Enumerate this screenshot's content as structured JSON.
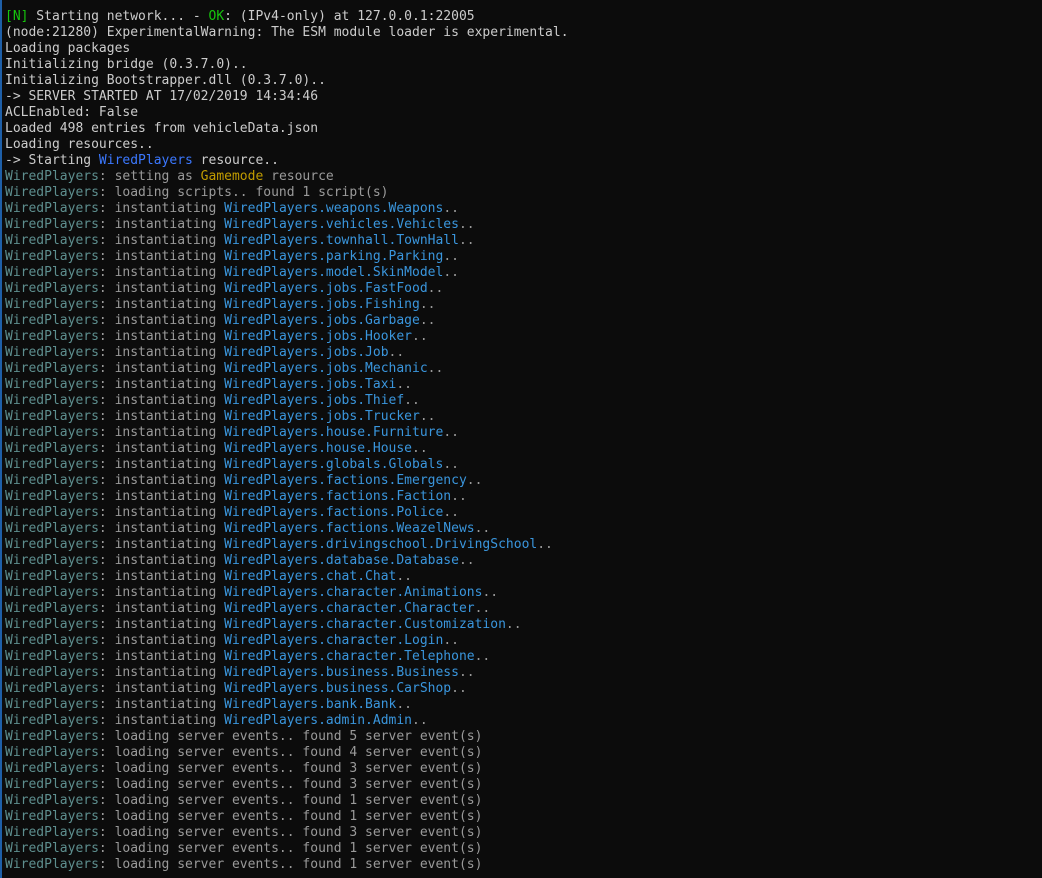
{
  "colors": {
    "background": "#0c0c0c",
    "default_text": "#cccccc",
    "green": "#16c60c",
    "blue": "#3b78ff",
    "wiredplayers_prefix": "#5e8f8f",
    "class_name": "#3a96dd",
    "left_border": "#1e5fa8"
  },
  "lines": [
    [
      {
        "text": "[N]",
        "color": "green"
      },
      {
        "text": " Starting network... - ",
        "color": "white"
      },
      {
        "text": "OK",
        "color": "green"
      },
      {
        "text": ": (IPv4-only) at 127.0.0.1:22005",
        "color": "white"
      }
    ],
    [
      {
        "text": "(node:21280) ExperimentalWarning: The ESM module loader is experimental.",
        "color": "white"
      }
    ],
    [
      {
        "text": "Loading packages",
        "color": "white"
      }
    ],
    [
      {
        "text": "Initializing bridge (0.3.7.0)..",
        "color": "white"
      }
    ],
    [
      {
        "text": "Initializing Bootstrapper.dll (0.3.7.0)..",
        "color": "white"
      }
    ],
    [
      {
        "text": "-> SERVER STARTED AT 17/02/2019 14:34:46",
        "color": "white"
      }
    ],
    [
      {
        "text": "ACLEnabled: False",
        "color": "white"
      }
    ],
    [
      {
        "text": "Loaded 498 entries from vehicleData.json",
        "color": "white"
      }
    ],
    [
      {
        "text": "Loading resources..",
        "color": "white"
      }
    ],
    [
      {
        "text": "-> Starting ",
        "color": "white"
      },
      {
        "text": "WiredPlayers",
        "color": "blue"
      },
      {
        "text": " resource..",
        "color": "white"
      }
    ],
    [
      {
        "text": "WiredPlayers",
        "color": "wp"
      },
      {
        "text": ": setting as ",
        "color": "gray"
      },
      {
        "text": "Gamemode",
        "color": "amber"
      },
      {
        "text": " resource",
        "color": "gray"
      }
    ],
    [
      {
        "text": "WiredPlayers",
        "color": "wp"
      },
      {
        "text": ": loading scripts.. found 1 script(s)",
        "color": "gray"
      }
    ],
    [
      {
        "text": "WiredPlayers",
        "color": "wp"
      },
      {
        "text": ": instantiating ",
        "color": "gray"
      },
      {
        "text": "WiredPlayers.weapons.Weapons",
        "color": "teal"
      },
      {
        "text": "..",
        "color": "gray"
      }
    ],
    [
      {
        "text": "WiredPlayers",
        "color": "wp"
      },
      {
        "text": ": instantiating ",
        "color": "gray"
      },
      {
        "text": "WiredPlayers.vehicles.Vehicles",
        "color": "teal"
      },
      {
        "text": "..",
        "color": "gray"
      }
    ],
    [
      {
        "text": "WiredPlayers",
        "color": "wp"
      },
      {
        "text": ": instantiating ",
        "color": "gray"
      },
      {
        "text": "WiredPlayers.townhall.TownHall",
        "color": "teal"
      },
      {
        "text": "..",
        "color": "gray"
      }
    ],
    [
      {
        "text": "WiredPlayers",
        "color": "wp"
      },
      {
        "text": ": instantiating ",
        "color": "gray"
      },
      {
        "text": "WiredPlayers.parking.Parking",
        "color": "teal"
      },
      {
        "text": "..",
        "color": "gray"
      }
    ],
    [
      {
        "text": "WiredPlayers",
        "color": "wp"
      },
      {
        "text": ": instantiating ",
        "color": "gray"
      },
      {
        "text": "WiredPlayers.model.SkinModel",
        "color": "teal"
      },
      {
        "text": "..",
        "color": "gray"
      }
    ],
    [
      {
        "text": "WiredPlayers",
        "color": "wp"
      },
      {
        "text": ": instantiating ",
        "color": "gray"
      },
      {
        "text": "WiredPlayers.jobs.FastFood",
        "color": "teal"
      },
      {
        "text": "..",
        "color": "gray"
      }
    ],
    [
      {
        "text": "WiredPlayers",
        "color": "wp"
      },
      {
        "text": ": instantiating ",
        "color": "gray"
      },
      {
        "text": "WiredPlayers.jobs.Fishing",
        "color": "teal"
      },
      {
        "text": "..",
        "color": "gray"
      }
    ],
    [
      {
        "text": "WiredPlayers",
        "color": "wp"
      },
      {
        "text": ": instantiating ",
        "color": "gray"
      },
      {
        "text": "WiredPlayers.jobs.Garbage",
        "color": "teal"
      },
      {
        "text": "..",
        "color": "gray"
      }
    ],
    [
      {
        "text": "WiredPlayers",
        "color": "wp"
      },
      {
        "text": ": instantiating ",
        "color": "gray"
      },
      {
        "text": "WiredPlayers.jobs.Hooker",
        "color": "teal"
      },
      {
        "text": "..",
        "color": "gray"
      }
    ],
    [
      {
        "text": "WiredPlayers",
        "color": "wp"
      },
      {
        "text": ": instantiating ",
        "color": "gray"
      },
      {
        "text": "WiredPlayers.jobs.Job",
        "color": "teal"
      },
      {
        "text": "..",
        "color": "gray"
      }
    ],
    [
      {
        "text": "WiredPlayers",
        "color": "wp"
      },
      {
        "text": ": instantiating ",
        "color": "gray"
      },
      {
        "text": "WiredPlayers.jobs.Mechanic",
        "color": "teal"
      },
      {
        "text": "..",
        "color": "gray"
      }
    ],
    [
      {
        "text": "WiredPlayers",
        "color": "wp"
      },
      {
        "text": ": instantiating ",
        "color": "gray"
      },
      {
        "text": "WiredPlayers.jobs.Taxi",
        "color": "teal"
      },
      {
        "text": "..",
        "color": "gray"
      }
    ],
    [
      {
        "text": "WiredPlayers",
        "color": "wp"
      },
      {
        "text": ": instantiating ",
        "color": "gray"
      },
      {
        "text": "WiredPlayers.jobs.Thief",
        "color": "teal"
      },
      {
        "text": "..",
        "color": "gray"
      }
    ],
    [
      {
        "text": "WiredPlayers",
        "color": "wp"
      },
      {
        "text": ": instantiating ",
        "color": "gray"
      },
      {
        "text": "WiredPlayers.jobs.Trucker",
        "color": "teal"
      },
      {
        "text": "..",
        "color": "gray"
      }
    ],
    [
      {
        "text": "WiredPlayers",
        "color": "wp"
      },
      {
        "text": ": instantiating ",
        "color": "gray"
      },
      {
        "text": "WiredPlayers.house.Furniture",
        "color": "teal"
      },
      {
        "text": "..",
        "color": "gray"
      }
    ],
    [
      {
        "text": "WiredPlayers",
        "color": "wp"
      },
      {
        "text": ": instantiating ",
        "color": "gray"
      },
      {
        "text": "WiredPlayers.house.House",
        "color": "teal"
      },
      {
        "text": "..",
        "color": "gray"
      }
    ],
    [
      {
        "text": "WiredPlayers",
        "color": "wp"
      },
      {
        "text": ": instantiating ",
        "color": "gray"
      },
      {
        "text": "WiredPlayers.globals.Globals",
        "color": "teal"
      },
      {
        "text": "..",
        "color": "gray"
      }
    ],
    [
      {
        "text": "WiredPlayers",
        "color": "wp"
      },
      {
        "text": ": instantiating ",
        "color": "gray"
      },
      {
        "text": "WiredPlayers.factions.Emergency",
        "color": "teal"
      },
      {
        "text": "..",
        "color": "gray"
      }
    ],
    [
      {
        "text": "WiredPlayers",
        "color": "wp"
      },
      {
        "text": ": instantiating ",
        "color": "gray"
      },
      {
        "text": "WiredPlayers.factions.Faction",
        "color": "teal"
      },
      {
        "text": "..",
        "color": "gray"
      }
    ],
    [
      {
        "text": "WiredPlayers",
        "color": "wp"
      },
      {
        "text": ": instantiating ",
        "color": "gray"
      },
      {
        "text": "WiredPlayers.factions.Police",
        "color": "teal"
      },
      {
        "text": "..",
        "color": "gray"
      }
    ],
    [
      {
        "text": "WiredPlayers",
        "color": "wp"
      },
      {
        "text": ": instantiating ",
        "color": "gray"
      },
      {
        "text": "WiredPlayers.factions.WeazelNews",
        "color": "teal"
      },
      {
        "text": "..",
        "color": "gray"
      }
    ],
    [
      {
        "text": "WiredPlayers",
        "color": "wp"
      },
      {
        "text": ": instantiating ",
        "color": "gray"
      },
      {
        "text": "WiredPlayers.drivingschool.DrivingSchool",
        "color": "teal"
      },
      {
        "text": "..",
        "color": "gray"
      }
    ],
    [
      {
        "text": "WiredPlayers",
        "color": "wp"
      },
      {
        "text": ": instantiating ",
        "color": "gray"
      },
      {
        "text": "WiredPlayers.database.Database",
        "color": "teal"
      },
      {
        "text": "..",
        "color": "gray"
      }
    ],
    [
      {
        "text": "WiredPlayers",
        "color": "wp"
      },
      {
        "text": ": instantiating ",
        "color": "gray"
      },
      {
        "text": "WiredPlayers.chat.Chat",
        "color": "teal"
      },
      {
        "text": "..",
        "color": "gray"
      }
    ],
    [
      {
        "text": "WiredPlayers",
        "color": "wp"
      },
      {
        "text": ": instantiating ",
        "color": "gray"
      },
      {
        "text": "WiredPlayers.character.Animations",
        "color": "teal"
      },
      {
        "text": "..",
        "color": "gray"
      }
    ],
    [
      {
        "text": "WiredPlayers",
        "color": "wp"
      },
      {
        "text": ": instantiating ",
        "color": "gray"
      },
      {
        "text": "WiredPlayers.character.Character",
        "color": "teal"
      },
      {
        "text": "..",
        "color": "gray"
      }
    ],
    [
      {
        "text": "WiredPlayers",
        "color": "wp"
      },
      {
        "text": ": instantiating ",
        "color": "gray"
      },
      {
        "text": "WiredPlayers.character.Customization",
        "color": "teal"
      },
      {
        "text": "..",
        "color": "gray"
      }
    ],
    [
      {
        "text": "WiredPlayers",
        "color": "wp"
      },
      {
        "text": ": instantiating ",
        "color": "gray"
      },
      {
        "text": "WiredPlayers.character.Login",
        "color": "teal"
      },
      {
        "text": "..",
        "color": "gray"
      }
    ],
    [
      {
        "text": "WiredPlayers",
        "color": "wp"
      },
      {
        "text": ": instantiating ",
        "color": "gray"
      },
      {
        "text": "WiredPlayers.character.Telephone",
        "color": "teal"
      },
      {
        "text": "..",
        "color": "gray"
      }
    ],
    [
      {
        "text": "WiredPlayers",
        "color": "wp"
      },
      {
        "text": ": instantiating ",
        "color": "gray"
      },
      {
        "text": "WiredPlayers.business.Business",
        "color": "teal"
      },
      {
        "text": "..",
        "color": "gray"
      }
    ],
    [
      {
        "text": "WiredPlayers",
        "color": "wp"
      },
      {
        "text": ": instantiating ",
        "color": "gray"
      },
      {
        "text": "WiredPlayers.business.CarShop",
        "color": "teal"
      },
      {
        "text": "..",
        "color": "gray"
      }
    ],
    [
      {
        "text": "WiredPlayers",
        "color": "wp"
      },
      {
        "text": ": instantiating ",
        "color": "gray"
      },
      {
        "text": "WiredPlayers.bank.Bank",
        "color": "teal"
      },
      {
        "text": "..",
        "color": "gray"
      }
    ],
    [
      {
        "text": "WiredPlayers",
        "color": "wp"
      },
      {
        "text": ": instantiating ",
        "color": "gray"
      },
      {
        "text": "WiredPlayers.admin.Admin",
        "color": "teal"
      },
      {
        "text": "..",
        "color": "gray"
      }
    ],
    [
      {
        "text": "WiredPlayers",
        "color": "wp"
      },
      {
        "text": ": loading server events.. found 5 server event(s)",
        "color": "gray"
      }
    ],
    [
      {
        "text": "WiredPlayers",
        "color": "wp"
      },
      {
        "text": ": loading server events.. found 4 server event(s)",
        "color": "gray"
      }
    ],
    [
      {
        "text": "WiredPlayers",
        "color": "wp"
      },
      {
        "text": ": loading server events.. found 3 server event(s)",
        "color": "gray"
      }
    ],
    [
      {
        "text": "WiredPlayers",
        "color": "wp"
      },
      {
        "text": ": loading server events.. found 3 server event(s)",
        "color": "gray"
      }
    ],
    [
      {
        "text": "WiredPlayers",
        "color": "wp"
      },
      {
        "text": ": loading server events.. found 1 server event(s)",
        "color": "gray"
      }
    ],
    [
      {
        "text": "WiredPlayers",
        "color": "wp"
      },
      {
        "text": ": loading server events.. found 1 server event(s)",
        "color": "gray"
      }
    ],
    [
      {
        "text": "WiredPlayers",
        "color": "wp"
      },
      {
        "text": ": loading server events.. found 3 server event(s)",
        "color": "gray"
      }
    ],
    [
      {
        "text": "WiredPlayers",
        "color": "wp"
      },
      {
        "text": ": loading server events.. found 1 server event(s)",
        "color": "gray"
      }
    ],
    [
      {
        "text": "WiredPlayers",
        "color": "wp"
      },
      {
        "text": ": loading server events.. found 1 server event(s)",
        "color": "gray"
      }
    ]
  ]
}
